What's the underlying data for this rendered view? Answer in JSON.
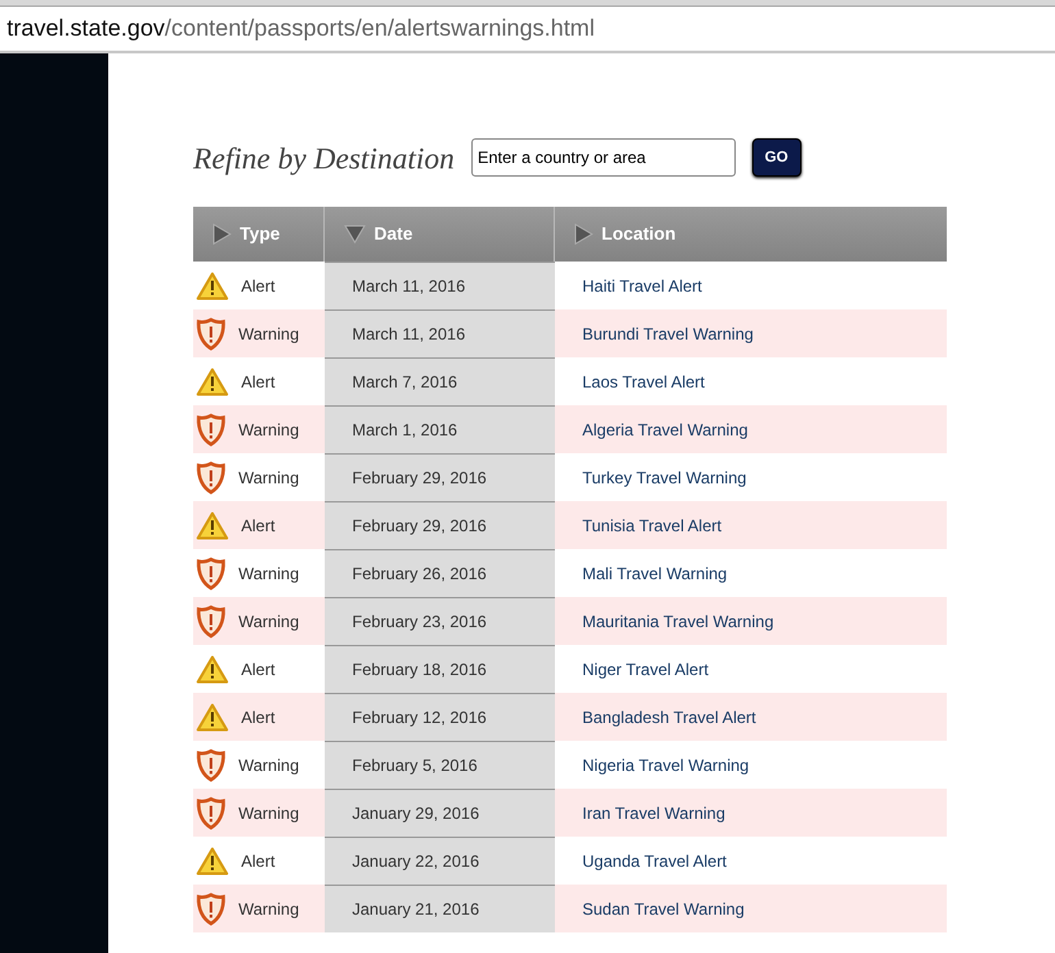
{
  "address_bar": {
    "domain": "travel.state.gov",
    "path": "/content/passports/en/alertswarnings.html"
  },
  "refine": {
    "title": "Refine by Destination",
    "placeholder": "Enter a country or area",
    "button": "GO"
  },
  "table": {
    "columns": [
      {
        "label": "Type",
        "sorted": false
      },
      {
        "label": "Date",
        "sorted": true
      },
      {
        "label": "Location",
        "sorted": false
      }
    ],
    "rows": [
      {
        "kind": "alert",
        "type": "Alert",
        "date": "March 11, 2016",
        "location": "Haiti Travel Alert"
      },
      {
        "kind": "warning",
        "type": "Warning",
        "date": "March 11, 2016",
        "location": "Burundi Travel Warning"
      },
      {
        "kind": "alert",
        "type": "Alert",
        "date": "March 7, 2016",
        "location": "Laos Travel Alert"
      },
      {
        "kind": "warning",
        "type": "Warning",
        "date": "March 1, 2016",
        "location": "Algeria Travel Warning"
      },
      {
        "kind": "warning",
        "type": "Warning",
        "date": "February 29, 2016",
        "location": "Turkey Travel Warning"
      },
      {
        "kind": "alert",
        "type": "Alert",
        "date": "February 29, 2016",
        "location": "Tunisia Travel Alert"
      },
      {
        "kind": "warning",
        "type": "Warning",
        "date": "February 26, 2016",
        "location": "Mali Travel Warning"
      },
      {
        "kind": "warning",
        "type": "Warning",
        "date": "February 23, 2016",
        "location": "Mauritania Travel Warning"
      },
      {
        "kind": "alert",
        "type": "Alert",
        "date": "February 18, 2016",
        "location": "Niger Travel Alert"
      },
      {
        "kind": "alert",
        "type": "Alert",
        "date": "February 12, 2016",
        "location": "Bangladesh Travel Alert"
      },
      {
        "kind": "warning",
        "type": "Warning",
        "date": "February 5, 2016",
        "location": "Nigeria Travel Warning"
      },
      {
        "kind": "warning",
        "type": "Warning",
        "date": "January 29, 2016",
        "location": "Iran Travel Warning"
      },
      {
        "kind": "alert",
        "type": "Alert",
        "date": "January 22, 2016",
        "location": "Uganda Travel Alert"
      },
      {
        "kind": "warning",
        "type": "Warning",
        "date": "January 21, 2016",
        "location": "Sudan Travel Warning"
      }
    ]
  }
}
